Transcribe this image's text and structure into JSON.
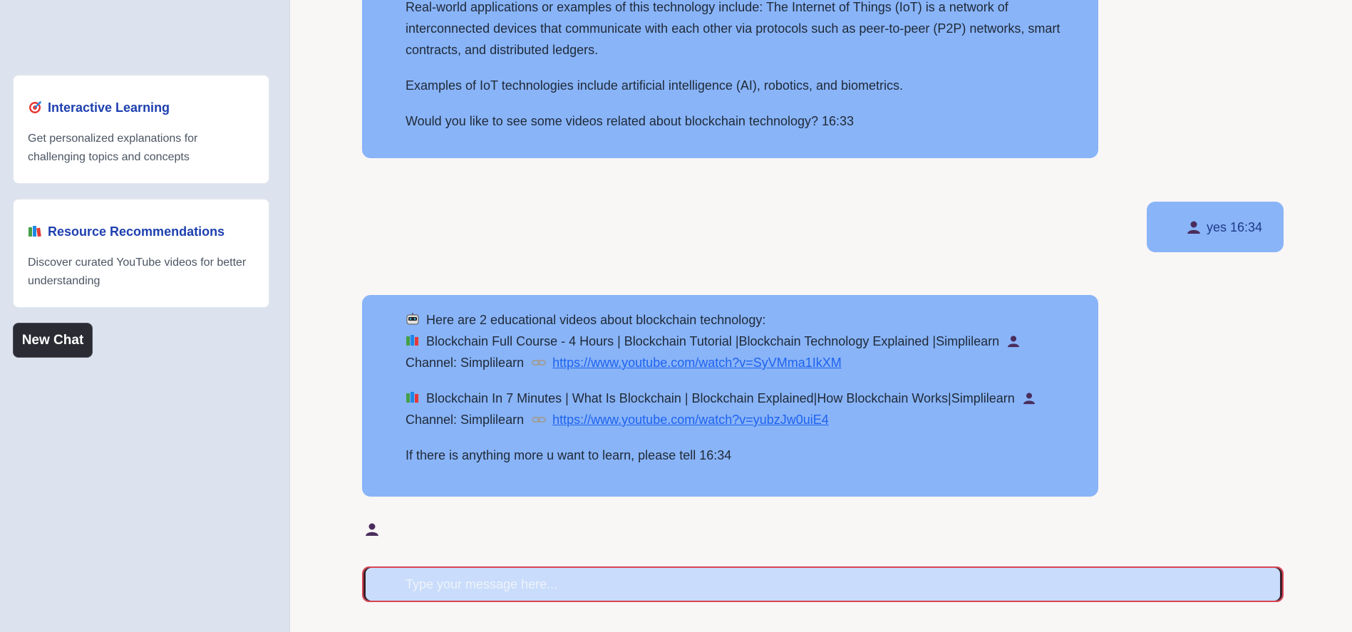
{
  "sidebar": {
    "cards": [
      {
        "icon": "target-icon",
        "title": "Interactive Learning",
        "description": "Get personalized explanations for challenging topics and concepts"
      },
      {
        "icon": "books-icon",
        "title": "Resource Recommendations",
        "description": "Discover curated YouTube videos for better understanding"
      }
    ],
    "new_chat_label": "New Chat"
  },
  "messages": {
    "bot_1": {
      "para_1": "Real-world applications or examples of this technology include: The Internet of Things (IoT) is a network of interconnected devices that communicate with each other via protocols such as peer-to-peer (P2P) networks, smart contracts, and distributed ledgers.",
      "para_2": "Examples of IoT technologies include artificial intelligence (AI), robotics, and biometrics.",
      "para_3": "Would you like to see some videos related about blockchain technology? 16:33"
    },
    "user_1": {
      "text": "yes 16:34"
    },
    "bot_2": {
      "intro": "Here are 2 educational videos about blockchain technology:",
      "videos": [
        {
          "title": "Blockchain Full Course - 4 Hours | Blockchain Tutorial |Blockchain Technology Explained |Simplilearn",
          "channel": "Channel: Simplilearn",
          "url": "https://www.youtube.com/watch?v=SyVMma1IkXM"
        },
        {
          "title": "Blockchain In 7 Minutes | What Is Blockchain | Blockchain Explained|How Blockchain Works|Simplilearn",
          "channel": "Channel: Simplilearn",
          "url": "https://www.youtube.com/watch?v=yubzJw0uiE4"
        }
      ],
      "closing": "If there is anything more u want to learn, please tell 16:34"
    }
  },
  "input": {
    "placeholder": "Type your message here..."
  }
}
